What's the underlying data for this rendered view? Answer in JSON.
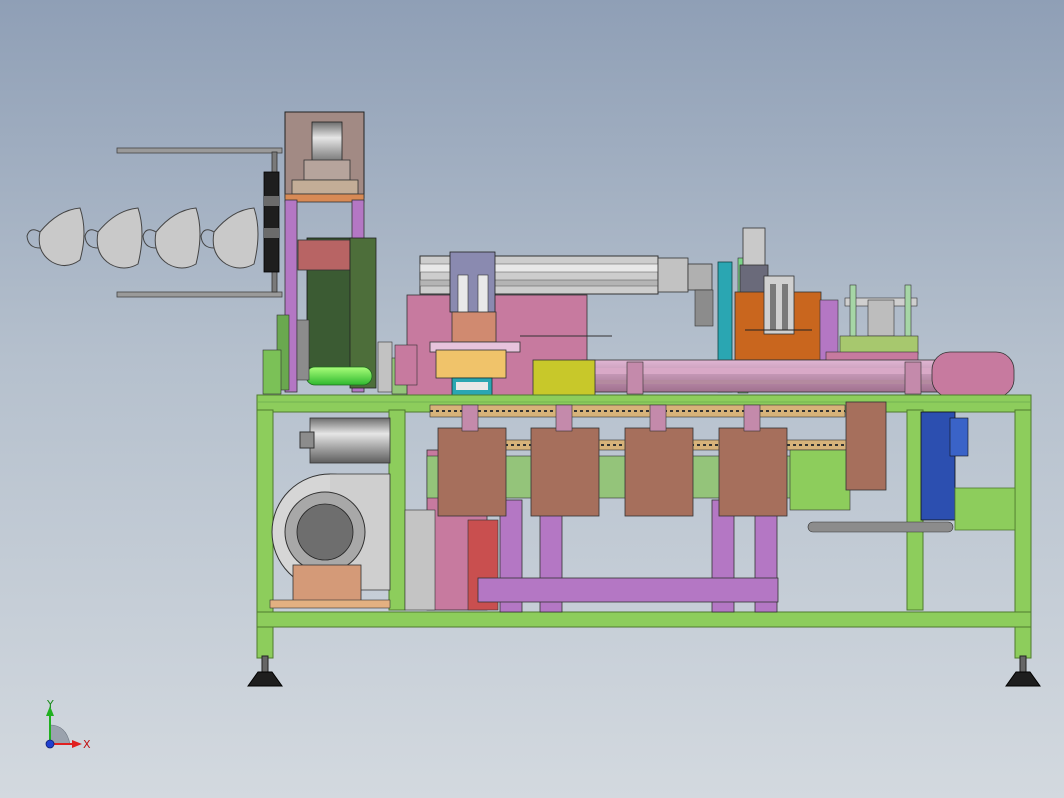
{
  "axis_triad": {
    "x_label": "X",
    "y_label": "Y",
    "x_color": "#e02020",
    "y_color": "#20b020",
    "origin_color": "#2040d0"
  },
  "palette": {
    "frame_green": "#8dcd5c",
    "frame_edge": "#4e7a2e",
    "bracket_purple": "#b477c4",
    "panel_pink": "#c77a9f",
    "block_brown": "#a66f5c",
    "cylinder_silver": "#a6a6a6",
    "motor_blue": "#2c4fb0",
    "accent_orange": "#c9661e",
    "accent_yellow": "#c8c82a",
    "accent_teal": "#2aa6b2"
  }
}
